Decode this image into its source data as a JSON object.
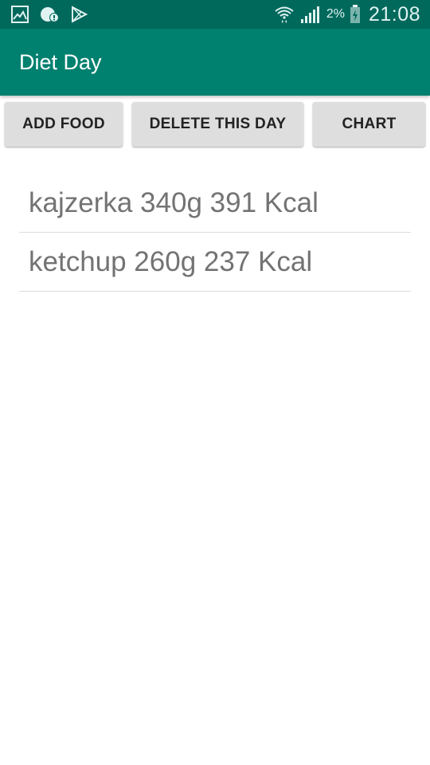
{
  "status_bar": {
    "icons_left": [
      "gallery-icon",
      "notification-icon",
      "play-store-icon"
    ],
    "icons_right": [
      "wifi-icon",
      "signal-icon",
      "battery-icon"
    ],
    "battery_percent": "2%",
    "time": "21:08"
  },
  "app_bar": {
    "title": "Diet Day"
  },
  "actions": {
    "add_food": "ADD FOOD",
    "delete_day": "DELETE THIS DAY",
    "chart": "CHART"
  },
  "food_items": [
    {
      "label": "kajzerka 340g 391 Kcal"
    },
    {
      "label": "ketchup 260g 237 Kcal"
    }
  ],
  "colors": {
    "status_bar": "#00695c",
    "app_bar": "#00806f",
    "button_bg": "#dedede",
    "item_text": "#737373"
  }
}
